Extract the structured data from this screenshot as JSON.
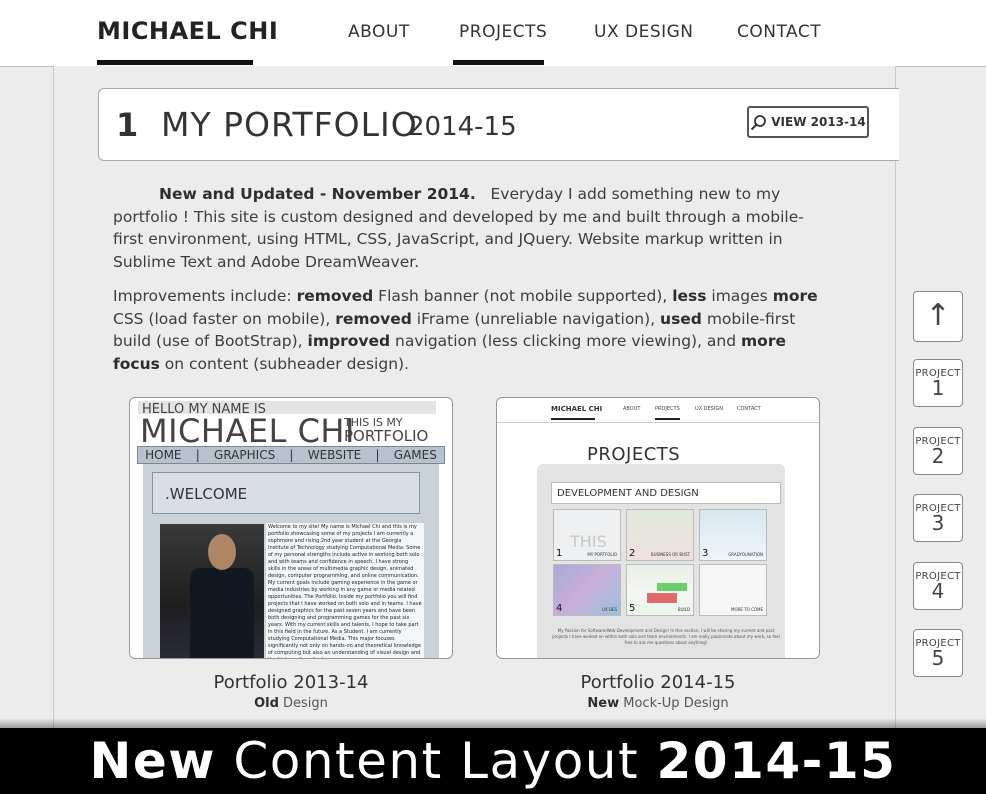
{
  "nav": {
    "brand": "MICHAEL CHI",
    "items": [
      {
        "label": "ABOUT"
      },
      {
        "label": "PROJECTS"
      },
      {
        "label": "UX DESIGN"
      },
      {
        "label": "CONTACT"
      }
    ],
    "active": "PROJECTS"
  },
  "section": {
    "number": "1",
    "title": "MY PORTFOLIO",
    "years": "2014-15",
    "view_button": "VIEW 2013-14"
  },
  "intro": {
    "lead_bold": "New and Updated - November 2014.",
    "lead_rest": "Everyday I add something new to my portfolio !",
    "body": "This site is custom designed and developed by me and built through a mobile-first environment, using HTML, CSS, JavaScript, and JQuery. Website markup written in Sublime Text and Adobe DreamWeaver."
  },
  "improvements": {
    "p0": "Improvements include: ",
    "b1": "removed",
    "p1": " Flash banner (not mobile supported), ",
    "b2": "less",
    "p2": " images ",
    "b3": "more",
    "p3": " CSS (load faster on mobile), ",
    "b4": "removed",
    "p4": " iFrame (unreliable navigation), ",
    "b5": "used",
    "p5": " mobile-first build (use of BootStrap), ",
    "b6": "improved",
    "p6": " navigation (less clicking more viewing), and ",
    "b7": "more focus",
    "p7": " on content (subheader design)."
  },
  "cards": [
    {
      "caption": "Portfolio 2013-14",
      "sub_bold": "Old",
      "sub_rest": " Design",
      "thumb": {
        "hello": "HELLO MY NAME IS",
        "name": "MICHAEL CHI",
        "sub1": "THIS IS MY",
        "sub2": "PORTFOLIO",
        "nav": [
          "HOME",
          "|",
          "GRAPHICS",
          "|",
          "WEBSITE",
          "|",
          "GAMES"
        ],
        "welcome": ".WELCOME",
        "text": "Welcome to my site! My name is Michael Chi and this is my portfolio showcasing some of my projects I am currently a sophmore and rising 2nd year student at the Georgia Institute of Technology studying Computational Media. Some of my personal strengths include active in working both solo and with teams and confidence in speech. I have strong skills in the areas of multimedia graphic design, animated design, computer programming, and online communication. My current goals include gaming experience in the game or media industries by working in any game or media related opportunities. The Portfolio. Inside my portfolio you will find projects that I have worked on both solo and in teams. I have designed graphics for the past seven years and have been both designing and programming games for the past six years. With my current skills and talents, I hope to take part in this field in the future. As a Student. I am currently studying Computational Media. This major focuses significantly not only on hands-on and theoretical knowledge of computing but also an understanding of visual design and the history of media. I am very eager"
      }
    },
    {
      "caption": "Portfolio 2014-15",
      "sub_bold": "New",
      "sub_rest": " Mock-Up Design",
      "thumb": {
        "brand": "MICHAEL CHI",
        "links": [
          "ABOUT",
          "PROJECTS",
          "UX DESIGN",
          "CONTACT"
        ],
        "title": "PROJECTS",
        "subheader": "DEVELOPMENT AND DESIGN",
        "tiles": [
          {
            "num": "1",
            "label": "MY PORTFOLIO"
          },
          {
            "num": "2",
            "label": "BUSINESS OR BUST"
          },
          {
            "num": "3",
            "label": "GRADYOUNATION"
          },
          {
            "num": "4",
            "label": "UX DES"
          },
          {
            "num": "5",
            "label": "BUILD"
          },
          {
            "num": "",
            "label": "MORE TO COME"
          }
        ],
        "footer": "My Passion for Software/Web Development and Design! In this section, I will be sharing my current and past projects I have worked on within both solo and team environments. I am really passionate about my work, so feel free to ask me questions about anything!"
      }
    }
  ],
  "side": {
    "up": "↑",
    "projects": [
      {
        "label": "PROJECT",
        "num": "1"
      },
      {
        "label": "PROJECT",
        "num": "2"
      },
      {
        "label": "PROJECT",
        "num": "3"
      },
      {
        "label": "PROJECT",
        "num": "4"
      },
      {
        "label": "PROJECT",
        "num": "5"
      }
    ]
  },
  "banner": {
    "bold1": "New",
    "middle": " Content Layout ",
    "bold2": "2014-15"
  },
  "colors": {
    "background": "#ececec",
    "banner": "#000000",
    "nav_active_bar": "#111111"
  },
  "icons": [
    "search-icon",
    "arrow-up-icon"
  ]
}
